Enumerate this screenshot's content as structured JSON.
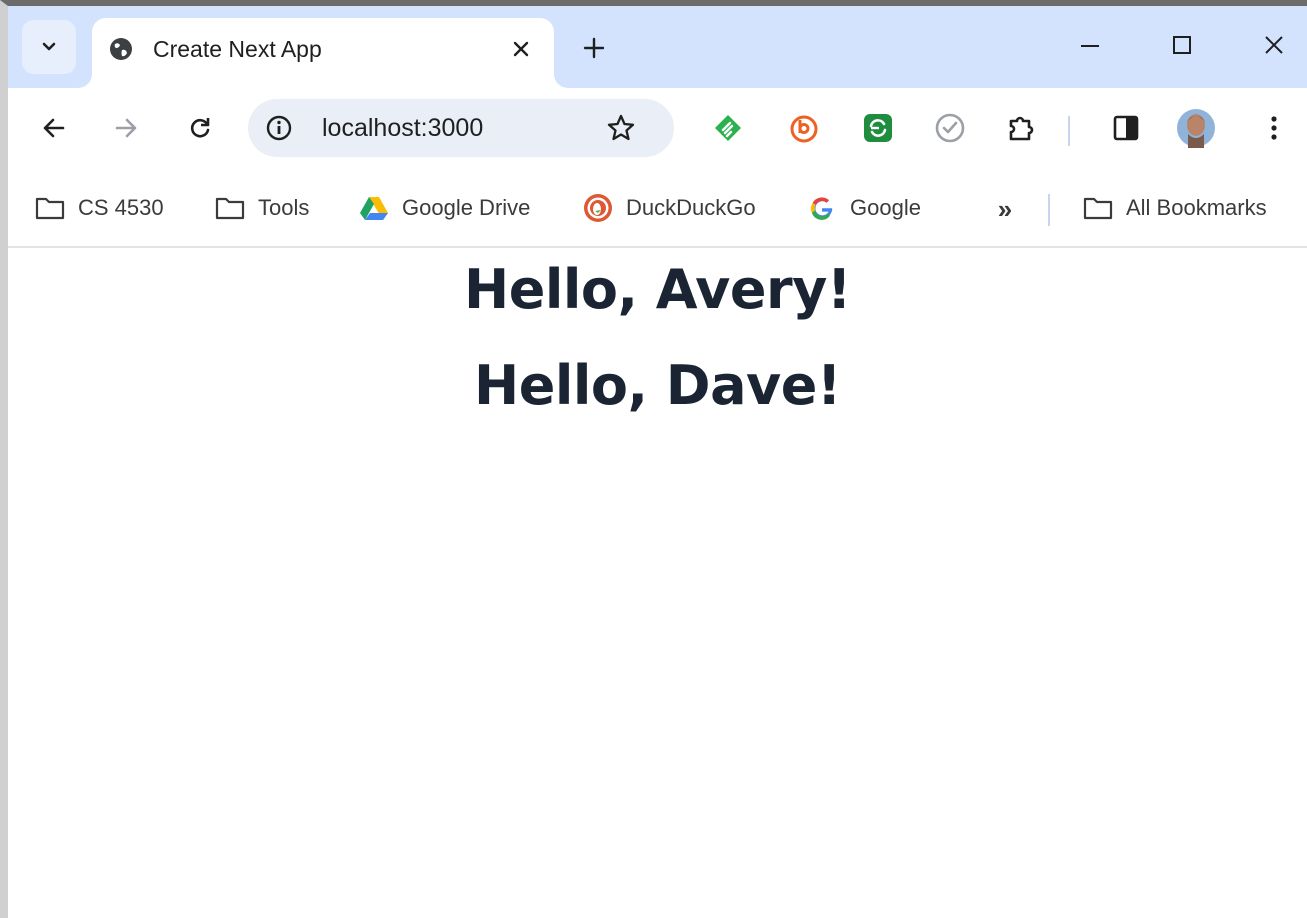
{
  "tab": {
    "title": "Create Next App",
    "favicon": "globe-icon"
  },
  "window_controls": {
    "minimize": "minimize-icon",
    "maximize": "maximize-icon",
    "close": "close-icon"
  },
  "toolbar": {
    "url": "localhost:3000"
  },
  "bookmarks": {
    "items": [
      {
        "label": "CS 4530",
        "icon": "folder-icon"
      },
      {
        "label": "Tools",
        "icon": "folder-icon"
      },
      {
        "label": "Google Drive",
        "icon": "google-drive-icon"
      },
      {
        "label": "DuckDuckGo",
        "icon": "duckduckgo-icon"
      },
      {
        "label": "Google",
        "icon": "google-icon"
      }
    ],
    "overflow": "»",
    "all_bookmarks": "All Bookmarks"
  },
  "page": {
    "greetings": [
      "Hello, Avery!",
      "Hello, Dave!"
    ]
  },
  "colors": {
    "tabstrip": "#d3e3fd",
    "omnibox": "#e9eef7",
    "heading": "#1b2433"
  }
}
